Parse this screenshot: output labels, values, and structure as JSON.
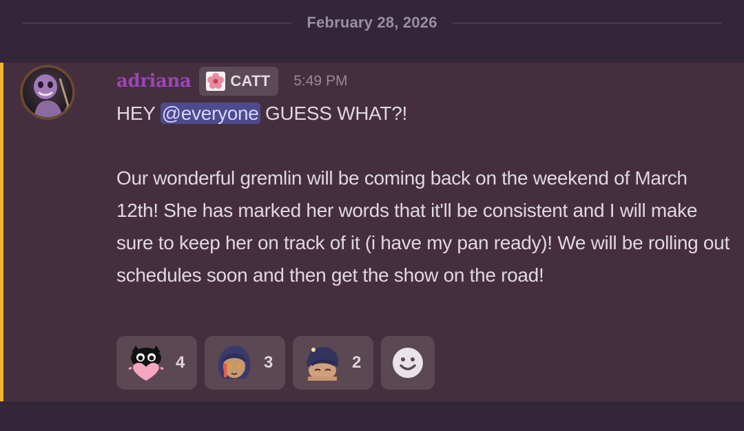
{
  "date_divider": "February 28, 2026",
  "message": {
    "author": "adriana",
    "tag": {
      "label": "CATT",
      "icon": "pink-flower-icon"
    },
    "timestamp": "5:49 PM",
    "line1_prefix": "HEY ",
    "mention": "@everyone",
    "line1_suffix": " GUESS WHAT?!",
    "body": "Our wonderful gremlin will be coming back on the weekend of March 12th! She has marked her words that it'll be consistent and I will make sure to keep her on track of it (i have my pan ready)! We will be rolling out schedules soon and then get the show on the road!",
    "mention_bar_color": "#f0b232",
    "username_color": "#9b44b8"
  },
  "reactions": [
    {
      "emoji": "black-cat-heart-emoji",
      "count": "4"
    },
    {
      "emoji": "anime-girl-face-emoji",
      "count": "3"
    },
    {
      "emoji": "anime-girl-peeking-emoji",
      "count": "2"
    }
  ],
  "add_reaction": {
    "icon": "smiley-add-reaction-icon"
  }
}
